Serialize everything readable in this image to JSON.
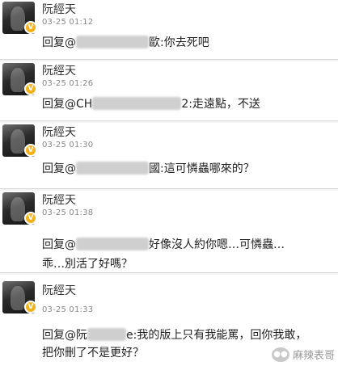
{
  "comments": [
    {
      "name": "阮經天",
      "time": "03-25 01:12",
      "reply_prefix": "回复@",
      "reply_suffix": "歐:你去死吧",
      "line2": ""
    },
    {
      "name": "阮經天",
      "time": "03-25 01:26",
      "reply_prefix": "回复@CH",
      "reply_suffix": "2:走遠點，不送",
      "line2": ""
    },
    {
      "name": "阮經天",
      "time": "03-25 01:30",
      "reply_prefix": "回复@",
      "reply_suffix": "國:這可憐蟲哪來的？",
      "line2": ""
    },
    {
      "name": "阮經天",
      "time": "03-25 01:38",
      "reply_prefix": "回复@",
      "reply_suffix": "好像沒人約你嗯…可憐蟲…",
      "line2": "乖…別活了好嗎？"
    },
    {
      "name": "阮經天",
      "time": "03-25 01:33",
      "reply_prefix": "回复@阮",
      "reply_suffix": "e:我的版上只有我能罵，回你我敢，",
      "line2": "把你刪了不是更好？"
    }
  ],
  "badge": "V",
  "watermark": {
    "text": "麻辣表哥",
    "icon": "wechat-icon"
  }
}
